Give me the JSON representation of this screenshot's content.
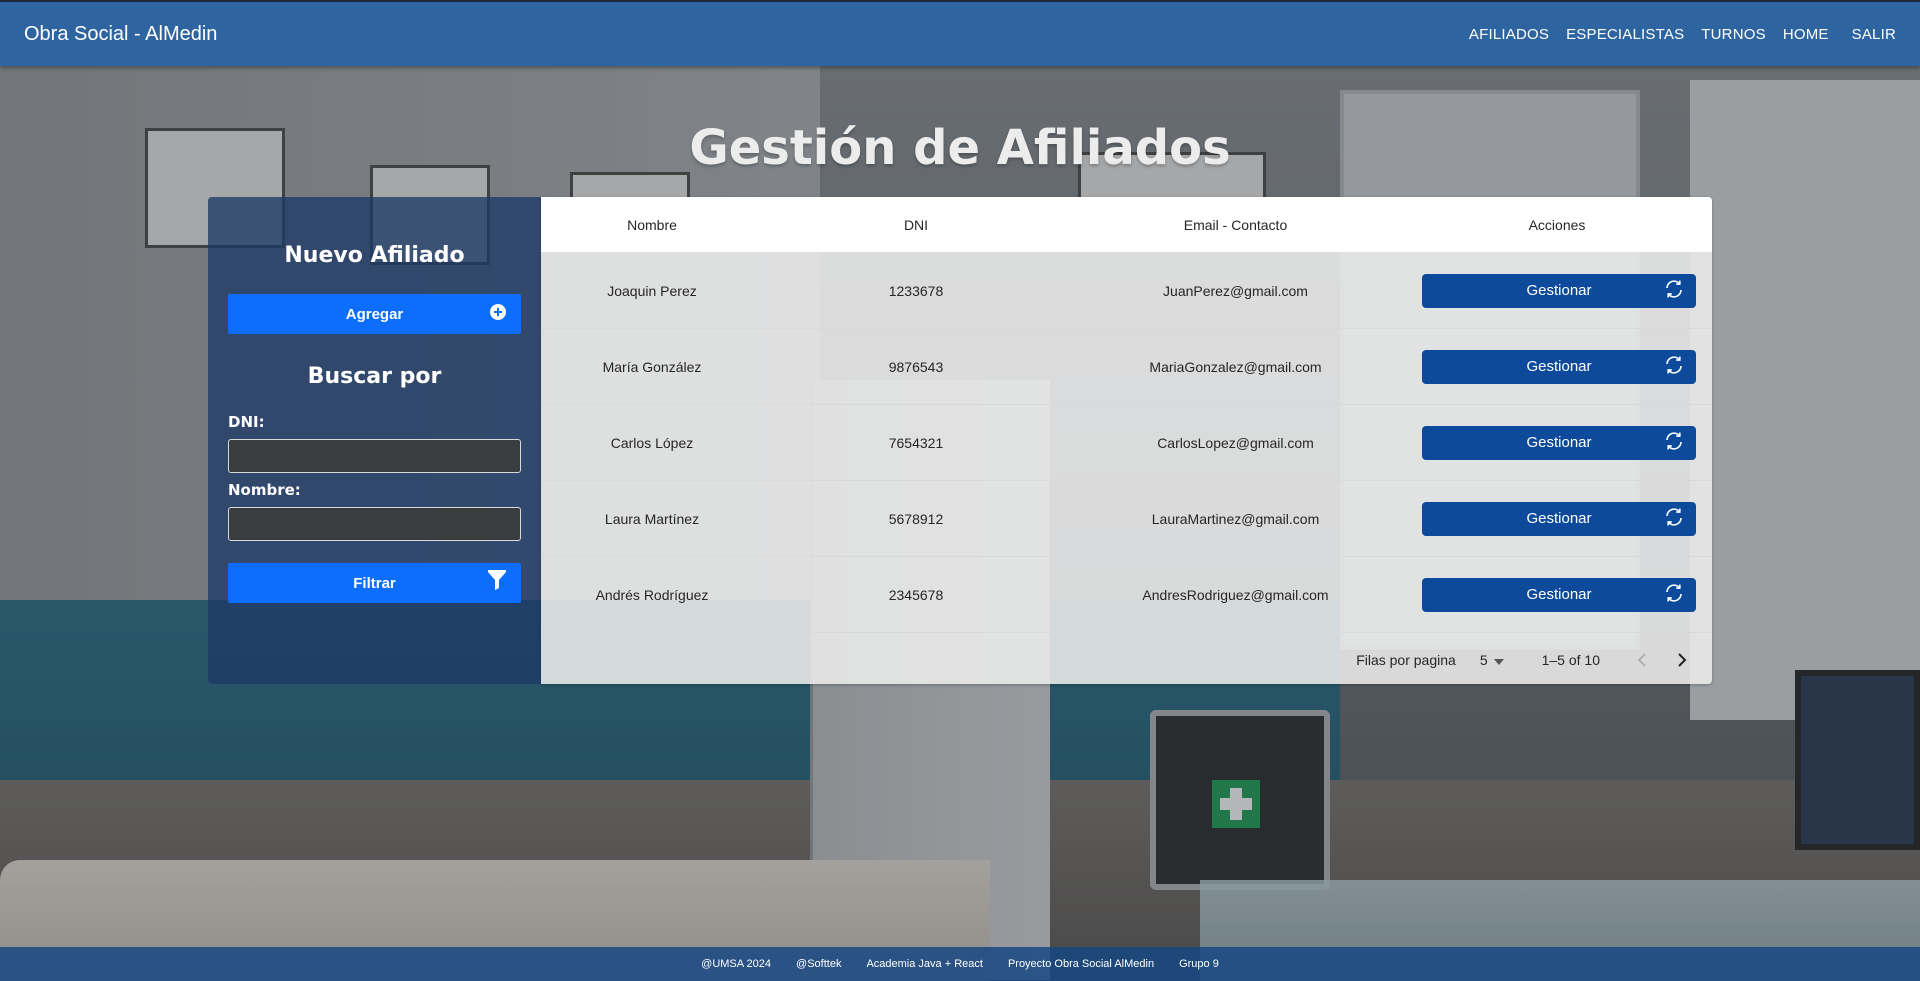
{
  "navbar": {
    "brand": "Obra Social - AlMedin",
    "links": [
      "AFILIADOS",
      "ESPECIALISTAS",
      "TURNOS",
      "HOME",
      "SALIR"
    ]
  },
  "page": {
    "title": "Gestión de Afiliados"
  },
  "sidebar": {
    "new_heading": "Nuevo Afiliado",
    "add_label": "Agregar",
    "search_heading": "Buscar por",
    "dni_label": "DNI:",
    "dni_value": "",
    "name_label": "Nombre:",
    "name_value": "",
    "filter_label": "Filtrar"
  },
  "table": {
    "headers": [
      "Nombre",
      "DNI",
      "Email - Contacto",
      "Acciones"
    ],
    "rows": [
      {
        "nombre": "Joaquin Perez",
        "dni": "1233678",
        "email": "JuanPerez@gmail.com",
        "action": "Gestionar"
      },
      {
        "nombre": "María González",
        "dni": "9876543",
        "email": "MariaGonzalez@gmail.com",
        "action": "Gestionar"
      },
      {
        "nombre": "Carlos López",
        "dni": "7654321",
        "email": "CarlosLopez@gmail.com",
        "action": "Gestionar"
      },
      {
        "nombre": "Laura Martínez",
        "dni": "5678912",
        "email": "LauraMartinez@gmail.com",
        "action": "Gestionar"
      },
      {
        "nombre": "Andrés Rodríguez",
        "dni": "2345678",
        "email": "AndresRodriguez@gmail.com",
        "action": "Gestionar"
      }
    ],
    "pagination": {
      "rows_label": "Filas por pagina",
      "rows_per_page": "5",
      "range": "1–5 of 10"
    }
  },
  "footer": {
    "items": [
      "@UMSA 2024",
      "@Softtek",
      "Academia Java + React",
      "Proyecto Obra Social AlMedin",
      "Grupo 9"
    ]
  },
  "icons": {
    "add": "plus-circle-icon",
    "filter": "filter-icon",
    "manage": "refresh-icon",
    "dropdown": "caret-down-icon",
    "prev": "chevron-left-icon",
    "next": "chevron-right-icon"
  },
  "colors": {
    "navbar": "#2e65a1",
    "primary_button": "#0d6efd",
    "manage_button": "#0d4a9c",
    "side_panel": "#1e3a66",
    "footer": "#184882"
  }
}
